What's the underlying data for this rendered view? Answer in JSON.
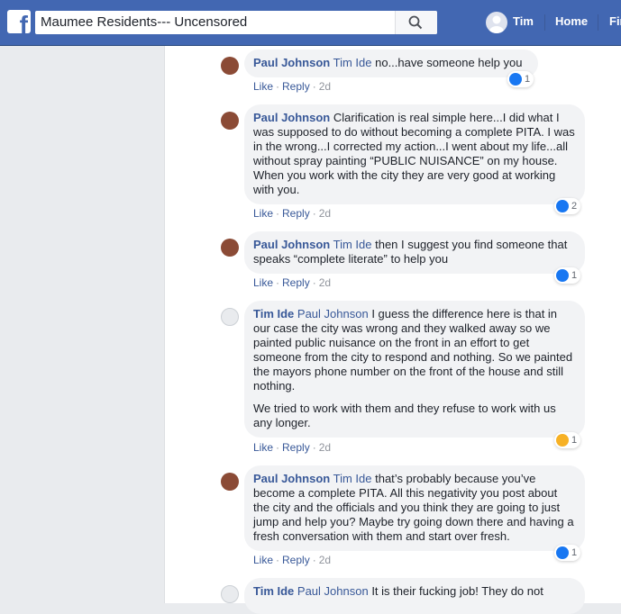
{
  "topbar": {
    "search_value": "Maumee Residents--- Uncensored",
    "user_name": "Tim",
    "home_label": "Home",
    "find_label": "Fin"
  },
  "actions": {
    "like": "Like",
    "reply": "Reply",
    "dot": "·"
  },
  "comments": [
    {
      "author": "Paul Johnson",
      "mention": "Tim Ide",
      "paragraphs": [
        "no...have someone help you"
      ],
      "time": "2d",
      "reaction": "like",
      "reaction_count": "1"
    },
    {
      "author": "Paul Johnson",
      "mention": "",
      "paragraphs": [
        "Clarification is real simple here...I did what I was supposed to do without becoming a complete PITA. I was in the wrong...I corrected my action...I went about my life...all without spray painting “PUBLIC NUISANCE” on my house. When you work with the city they are very good at working with you."
      ],
      "time": "2d",
      "reaction": "like",
      "reaction_count": "2"
    },
    {
      "author": "Paul Johnson",
      "mention": "Tim Ide",
      "paragraphs": [
        "then I suggest you find someone that speaks “complete literate” to help you"
      ],
      "time": "2d",
      "reaction": "like",
      "reaction_count": "1"
    },
    {
      "author": "Tim Ide",
      "mention": "Paul Johnson",
      "paragraphs": [
        "I guess the difference here is that in our case the city was wrong and they walked away so we painted public nuisance on the front in an effort to get someone from the city to respond and nothing. So we painted the mayors phone number on the front of the house and still nothing.",
        "We tried to work with them and they refuse to work with us any longer."
      ],
      "time": "2d",
      "reaction": "sad",
      "reaction_count": "1"
    },
    {
      "author": "Paul Johnson",
      "mention": "Tim Ide",
      "paragraphs": [
        "that’s probably because you’ve become a complete PITA. All this negativity you post about the city and the officials and you think they are going to just jump and help you? Maybe try going down there and having a fresh conversation with them and start over fresh."
      ],
      "time": "2d",
      "reaction": "like",
      "reaction_count": "1"
    },
    {
      "author": "Tim Ide",
      "mention": "Paul Johnson",
      "paragraphs": [
        "It is their fucking job! They do not"
      ],
      "time": "",
      "reaction": "",
      "reaction_count": ""
    }
  ]
}
